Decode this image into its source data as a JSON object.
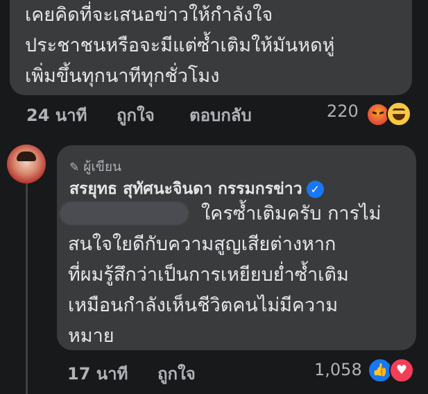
{
  "comment1": {
    "lines": [
      "เคยคิดที่จะเสนอข่าวให้กำลังใจ",
      "ประชาชนหรือจะมีแต่ซ้ำเติมให้มันหดหู่",
      "เพิ่มขึ้นทุกนาทีทุกชั่วโมง"
    ],
    "time": "24 นาที",
    "like_label": "ถูกใจ",
    "reply_label": "ตอบกลับ",
    "reaction_count": "220",
    "reactions": [
      "angry-icon",
      "haha-icon"
    ]
  },
  "reply": {
    "author_badge": "ผู้เขียน",
    "author_name": "สรยุทธ สุทัศนะจินดา กรรมกรข่าว",
    "first_line": "ใครซ้ำเติมครับ การไม่",
    "lines": [
      "สนใจใยดีกับความสูญเสียต่างหาก",
      "ที่ผมรู้สึกว่าเป็นการเหยียบย่ำซ้ำเติม",
      "เหมือนกำลังเห็นชีวิตคนไม่มีความ",
      "หมาย"
    ],
    "time": "17 นาที",
    "like_label": "ถูกใจ",
    "reaction_count": "1,058",
    "reactions": [
      "like-icon",
      "love-icon"
    ]
  },
  "colors": {
    "background": "#18191a",
    "bubble": "#3a3b3c",
    "text": "#e4e6eb",
    "muted": "#b0b3b8",
    "verified": "#1877f2"
  }
}
